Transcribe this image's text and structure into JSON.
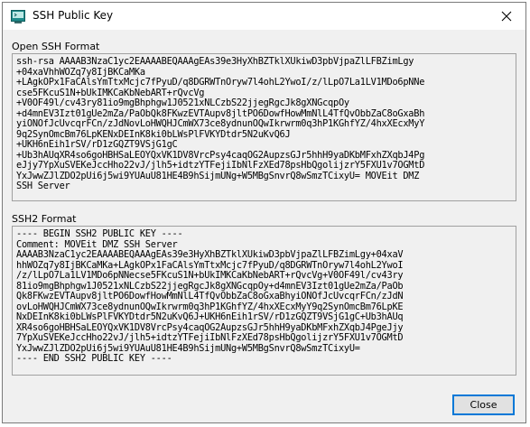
{
  "window": {
    "title": "SSH Public Key"
  },
  "open_ssh": {
    "label": "Open SSH Format",
    "lines": [
      "ssh-rsa AAAAB3NzaC1yc2EAAAABEQAAAgEAs39e3HyXhBZTklXUkiwD3pbVjpaZlLFBZimLgy",
      "+04xaVhhWOZq7y8IjBKCaMKa",
      "+LAgkOPx1FaCAlsYmTtxMcjc7fPyuD/q8DGRWTnOryw7l4ohL2YwoI/z/lLpO7La1LV1MDo6pNNe",
      "cse5FKcuS1N+bUkIMKCaKbNebART+rQvcVg",
      "+V0OF49l/cv43ry81io9mgBhphgw1J0521xNLCzbS22jjegRgcJk8gXNGcqpOy",
      "+d4mnEV3Izt01gUe2mZa/PaObQk8FKwzEVTAupv8jltPO6DowfHowMmNlL4TfQvObbZaC8oGxaBh",
      "yiONOfJcUvcqrFCn/zJdNovLoHWQHJCmWX73ce8ydnunOQwIkrwrm0q3hP1KGhfYZ/4hxXEcxMyY",
      "9q2SynOmcBm76LpKENxDEInK8ki0bLWsPlFVKYDtdr5N2uKvQ6J",
      "+UKH6nEih1rSV/rD1zGQZT9VSjG1gC",
      "+Ub3hAUqXR4so6goHBHSaLEOYQxVK1DV8VrcPsy4caqOG2AupzsGJr5hhH9yaDKbMFxhZXqbJ4Pg",
      "eJjy7YpXuSVEKeJccHho22vJ/jlh5+idtzYTFejiIbNlFzXEd78psHbQgolijzrY5FXU1v7OGMtD",
      "YxJwwZJlZDO2pUi6j5wi9YUAuU81HE4B9hSijmUNg+W5MBgSnvrQ8wSmzTCixyU= MOVEit DMZ",
      "SSH Server"
    ]
  },
  "ssh2": {
    "label": "SSH2 Format",
    "lines": [
      "---- BEGIN SSH2 PUBLIC KEY ----",
      "Comment: MOVEit DMZ SSH Server",
      "AAAAB3NzaC1yc2EAAAABEQAAAgEAs39e3HyXhBZTklXUkiwD3pbVjpaZlLFBZimLgy+04xaV",
      "hhWOZq7y8IjBKCaMKa+LAgkOPx1FaCAlsYmTtxMcjc7fPyuD/q8DGRWTnOryw7l4ohL2YwoI",
      "/z/lLpO7La1LV1MDo6pNNecse5FKcuS1N+bUkIMKCaKbNebART+rQvcVg+V0OF49l/cv43ry",
      "81io9mgBhphgw1J0521xNLCzbS22jjegRgcJk8gXNGcqpOy+d4mnEV3Izt01gUe2mZa/PaOb",
      "Qk8FKwzEVTAupv8jltPO6DowfHowMmNlL4TfQvObbZaC8oGxaBhyiONOfJcUvcqrFCn/zJdN",
      "ovLoHWQHJCmWX73ce8ydnunOQwIkrwrm0q3hP1KGhfYZ/4hxXEcxMyY9q2SynOmcBm76LpKE",
      "NxDEInK8ki0bLWsPlFVKYDtdr5N2uKvQ6J+UKH6nEih1rSV/rD1zGQZT9VSjG1gC+Ub3hAUq",
      "XR4so6goHBHSaLEOYQxVK1DV8VrcPsy4caqOG2AupzsGJr5hhH9yaDKbMFxhZXqbJ4PgeJjy",
      "7YpXuSVEKeJccHho22vJ/jlh5+idtzYTFejiIbNlFzXEd78psHbQgolijzrY5FXU1v7OGMtD",
      "YxJwwZJlZDO2pUi6j5wi9YUAuU81HE4B9hSijmUNg+W5MBgSnvrQ8wSmzTCixyU=",
      "---- END SSH2 PUBLIC KEY ----"
    ]
  },
  "buttons": {
    "close_label": "Close"
  },
  "icons": {
    "app": "terminal-icon",
    "close": "close-icon"
  }
}
